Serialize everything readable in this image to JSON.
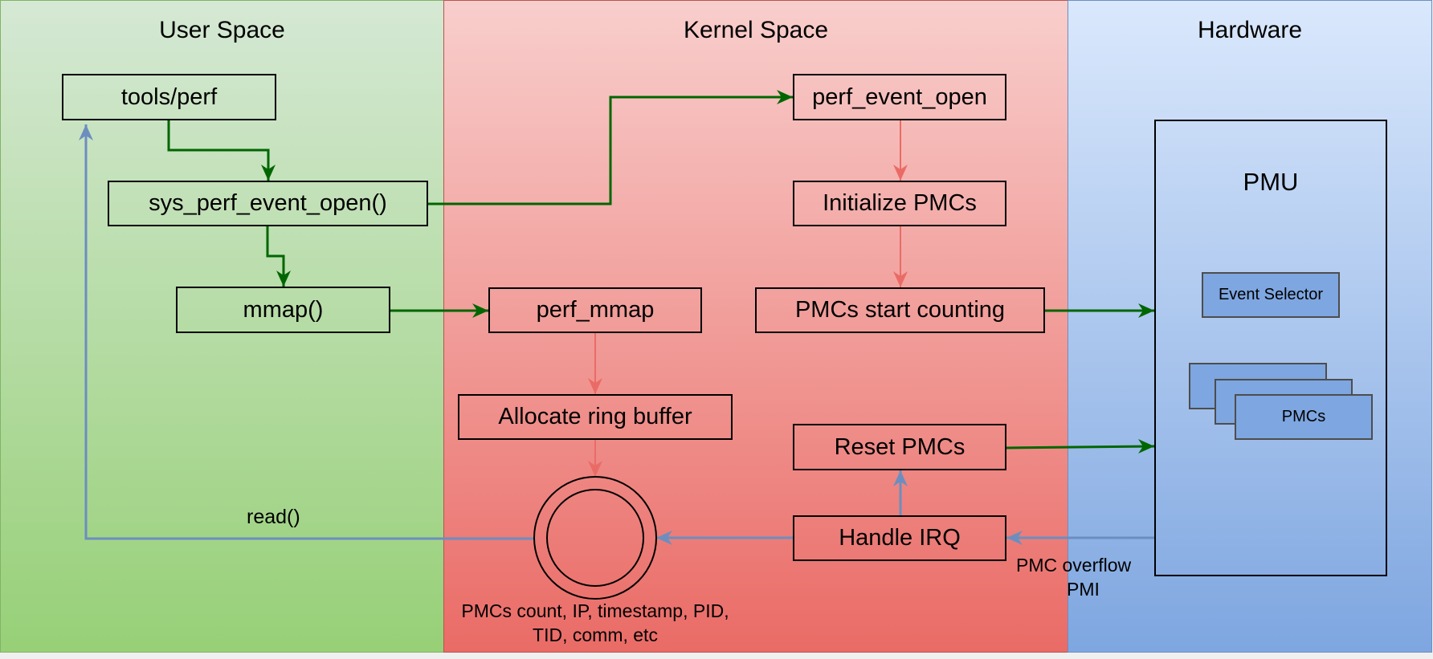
{
  "lanes": {
    "user": "User Space",
    "kernel": "Kernel Space",
    "hardware": "Hardware"
  },
  "user_nodes": {
    "tools_perf": "tools/perf",
    "sys_perf_event_open": "sys_perf_event_open()",
    "mmap": "mmap()"
  },
  "kernel_nodes": {
    "perf_event_open": "perf_event_open",
    "initialize_pmcs": "Initialize PMCs",
    "pmcs_start_counting": "PMCs start counting",
    "perf_mmap": "perf_mmap",
    "allocate_ring_buffer": "Allocate ring buffer",
    "reset_pmcs": "Reset PMCs",
    "handle_irq": "Handle IRQ",
    "ring_buffer_caption_line1": "PMCs count, IP, timestamp, PID,",
    "ring_buffer_caption_line2": "TID, comm, etc"
  },
  "hardware_nodes": {
    "pmu": "PMU",
    "event_selector": "Event Selector",
    "pmcs": "PMCs"
  },
  "edge_labels": {
    "read": "read()",
    "pmc_overflow": "PMC overflow",
    "pmi": "PMI"
  },
  "colors": {
    "control_flow": "#006600",
    "kernel_flow": "#ea6b66",
    "data_flow": "#6c8ebf"
  }
}
